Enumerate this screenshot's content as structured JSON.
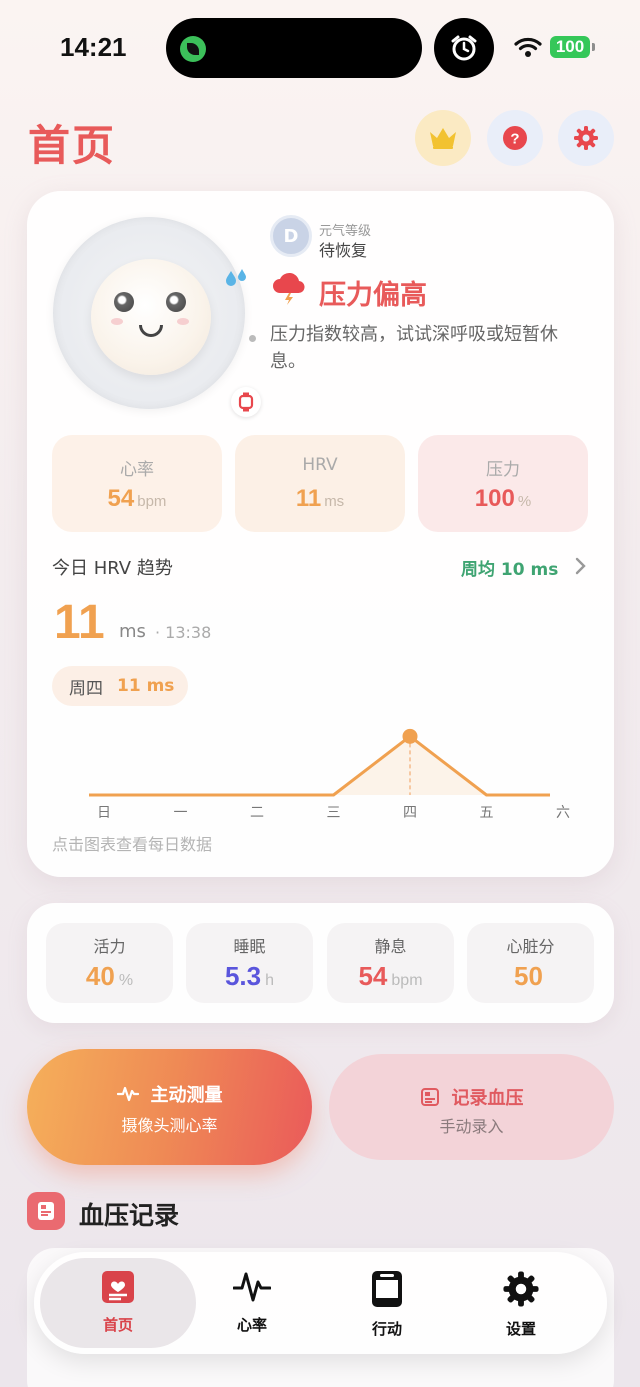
{
  "status_bar": {
    "time": "14:21",
    "battery": "100"
  },
  "header": {
    "title": "首页"
  },
  "mood": {
    "level_avatar": "D",
    "level_label": "元气等级",
    "level_value": "待恢复",
    "status_title": "压力偏高",
    "status_desc": "压力指数较高，试试深呼吸或短暂休息。"
  },
  "metrics": [
    {
      "label": "心率",
      "value": "54",
      "unit": "bpm"
    },
    {
      "label": "HRV",
      "value": "11",
      "unit": "ms"
    },
    {
      "label": "压力",
      "value": "100",
      "unit": "%"
    }
  ],
  "hrv": {
    "heading": "今日 HRV 趋势",
    "weekly_avg": "周均 10 ms",
    "current_value": "11",
    "current_unit": "ms",
    "current_time": "· 13:38",
    "selected_day": "周四",
    "selected_value": "11 ms",
    "hint": "点击图表查看每日数据"
  },
  "chart_data": {
    "type": "line",
    "categories": [
      "日",
      "一",
      "二",
      "三",
      "四",
      "五",
      "六"
    ],
    "values": [
      0,
      0,
      0,
      0,
      11,
      0,
      0
    ],
    "selected_index": 4,
    "ylim": [
      0,
      12
    ]
  },
  "stats": [
    {
      "label": "活力",
      "value": "40",
      "unit": "%"
    },
    {
      "label": "睡眠",
      "value": "5.3",
      "unit": "h"
    },
    {
      "label": "静息",
      "value": "54",
      "unit": "bpm"
    },
    {
      "label": "心脏分",
      "value": "50",
      "unit": ""
    }
  ],
  "actions": {
    "measure_title": "主动测量",
    "measure_sub": "摄像头测心率",
    "record_title": "记录血压",
    "record_sub": "手动录入"
  },
  "bp_section": {
    "title": "血压记录"
  },
  "tabbar": [
    {
      "label": "首页",
      "icon": "home-card-icon"
    },
    {
      "label": "心率",
      "icon": "pulse-icon"
    },
    {
      "label": "行动",
      "icon": "phone-card-icon"
    },
    {
      "label": "设置",
      "icon": "gear-icon"
    }
  ],
  "colors": {
    "accent_red": "#e85a5a",
    "accent_orange": "#f0a150",
    "accent_green": "#3fa472",
    "accent_purple": "#5a55dc"
  }
}
